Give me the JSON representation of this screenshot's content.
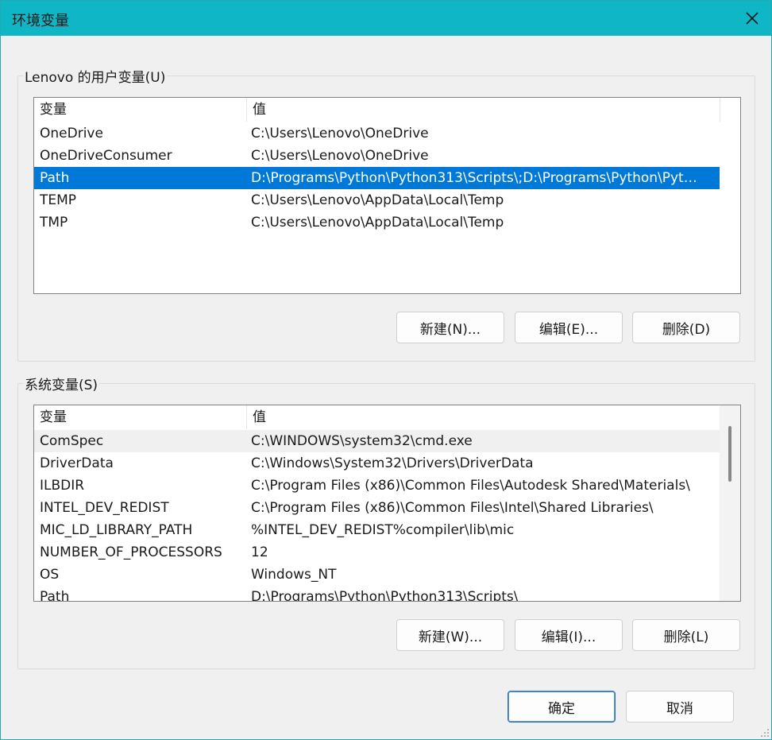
{
  "window": {
    "title": "环境变量",
    "colors": {
      "titlebar": "#0fb7c6",
      "selection": "#0078d7"
    }
  },
  "user_vars": {
    "legend": "Lenovo 的用户变量(U)",
    "columns": [
      "变量",
      "值"
    ],
    "rows": [
      {
        "name": "OneDrive",
        "value": "C:\\Users\\Lenovo\\OneDrive"
      },
      {
        "name": "OneDriveConsumer",
        "value": "C:\\Users\\Lenovo\\OneDrive"
      },
      {
        "name": "Path",
        "value": "D:\\Programs\\Python\\Python313\\Scripts\\;D:\\Programs\\Python\\Pyt…"
      },
      {
        "name": "TEMP",
        "value": "C:\\Users\\Lenovo\\AppData\\Local\\Temp"
      },
      {
        "name": "TMP",
        "value": "C:\\Users\\Lenovo\\AppData\\Local\\Temp"
      }
    ],
    "selected_row": "Path",
    "buttons": {
      "new": "新建(N)...",
      "edit": "编辑(E)...",
      "delete": "删除(D)"
    }
  },
  "system_vars": {
    "legend": "系统变量(S)",
    "columns": [
      "变量",
      "值"
    ],
    "rows": [
      {
        "name": "ComSpec",
        "value": "C:\\WINDOWS\\system32\\cmd.exe"
      },
      {
        "name": "DriverData",
        "value": "C:\\Windows\\System32\\Drivers\\DriverData"
      },
      {
        "name": "ILBDIR",
        "value": "C:\\Program Files (x86)\\Common Files\\Autodesk Shared\\Materials\\"
      },
      {
        "name": "INTEL_DEV_REDIST",
        "value": "C:\\Program Files (x86)\\Common Files\\Intel\\Shared Libraries\\"
      },
      {
        "name": "MIC_LD_LIBRARY_PATH",
        "value": "%INTEL_DEV_REDIST%compiler\\lib\\mic"
      },
      {
        "name": "NUMBER_OF_PROCESSORS",
        "value": "12"
      },
      {
        "name": "OS",
        "value": "Windows_NT"
      },
      {
        "name": "Path",
        "value": "D:\\Programs\\Python\\Python313\\Scripts\\"
      }
    ],
    "hovered_row": "ComSpec",
    "buttons": {
      "new": "新建(W)...",
      "edit": "编辑(I)...",
      "delete": "删除(L)"
    }
  },
  "footer": {
    "ok": "确定",
    "cancel": "取消"
  }
}
